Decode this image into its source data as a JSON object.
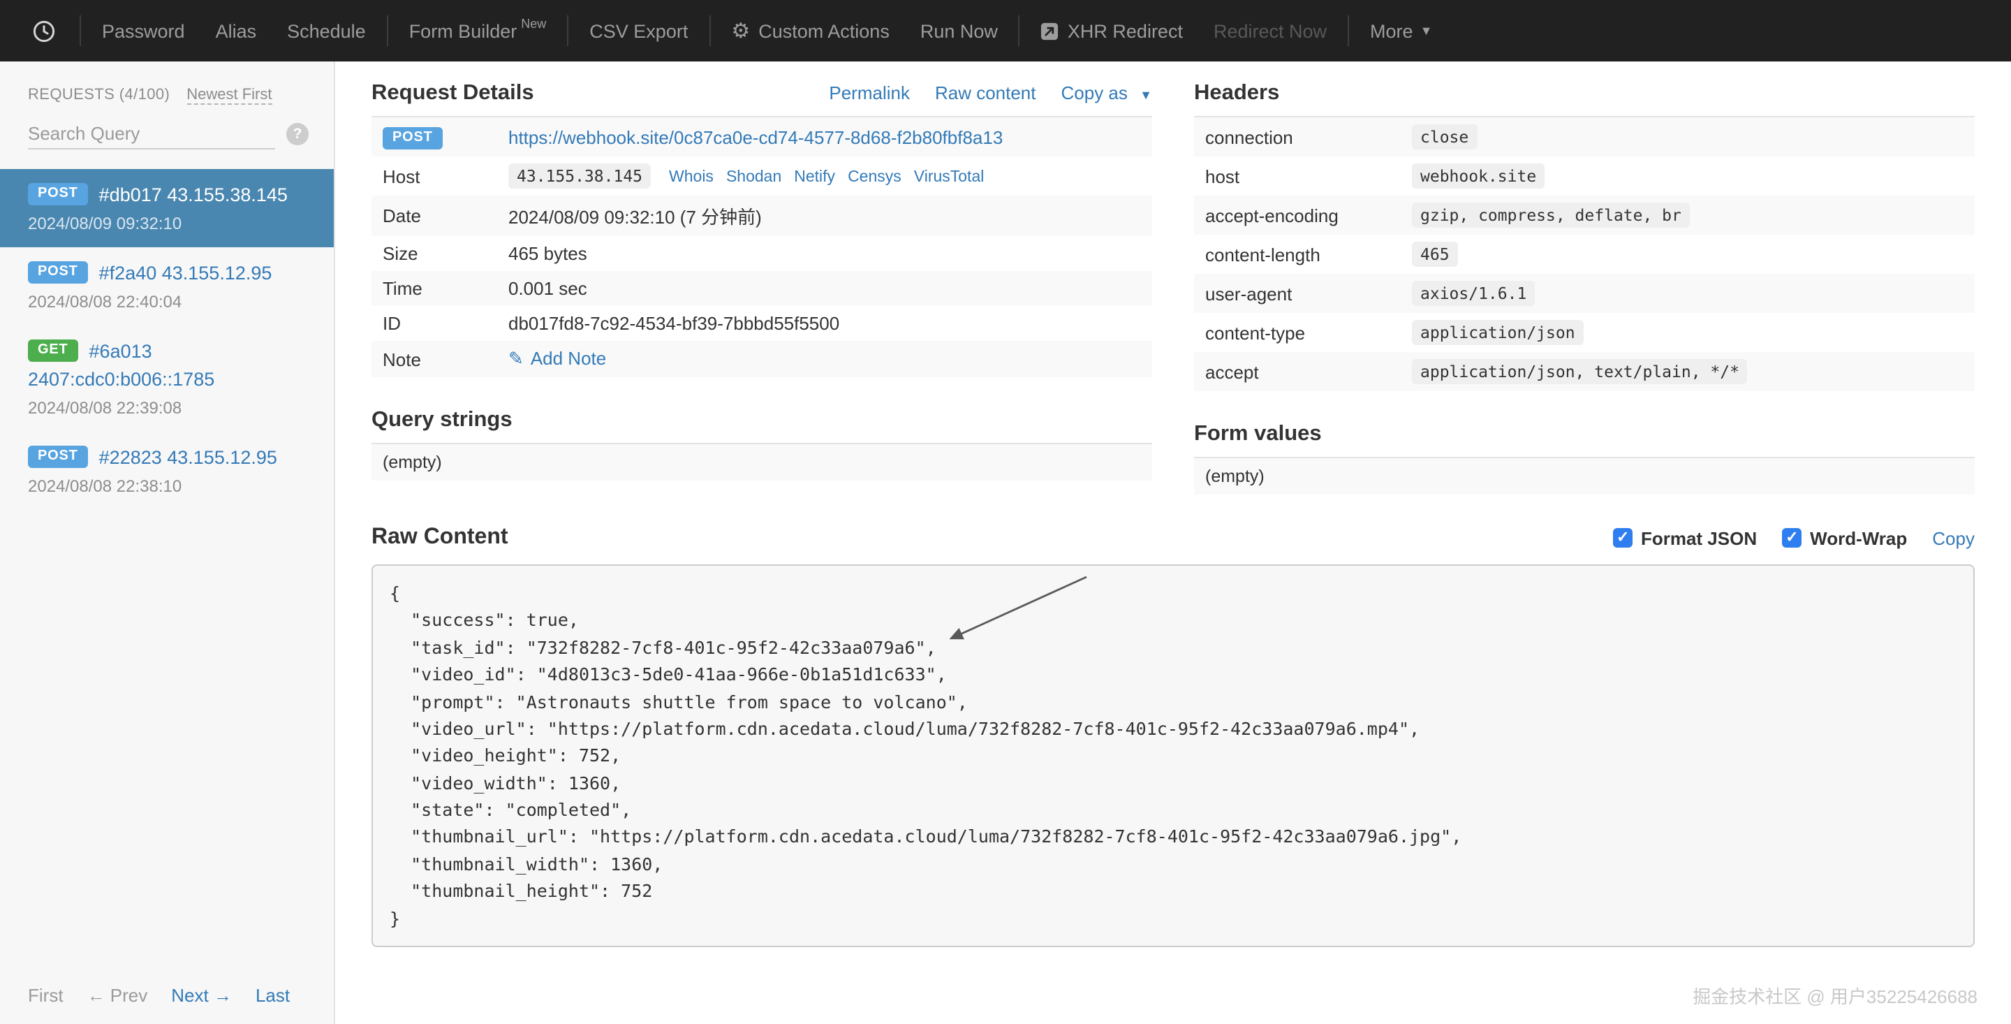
{
  "theme": {
    "link": "#337ab7",
    "post": "#57a4e1",
    "get": "#4cae4c",
    "selected": "#4a87b0",
    "navbg": "#212121",
    "check": "#2e7ef0"
  },
  "nav": {
    "password": "Password",
    "alias": "Alias",
    "schedule": "Schedule",
    "form_builder": "Form Builder",
    "form_builder_badge": "New",
    "csv_export": "CSV Export",
    "custom_actions": "Custom Actions",
    "run_now": "Run Now",
    "xhr_redirect": "XHR Redirect",
    "redirect_now": "Redirect Now",
    "more": "More"
  },
  "sidebar": {
    "header": "REQUESTS (4/100)",
    "sort_label": "Newest First",
    "search_placeholder": "Search Query",
    "requests": [
      {
        "method": "POST",
        "title": "#db017 43.155.38.145",
        "date": "2024/08/09 09:32:10"
      },
      {
        "method": "POST",
        "title": "#f2a40 43.155.12.95",
        "date": "2024/08/08 22:40:04"
      },
      {
        "method": "GET",
        "title": "#6a013",
        "subtitle": "2407:cdc0:b006::1785",
        "date": "2024/08/08 22:39:08"
      },
      {
        "method": "POST",
        "title": "#22823 43.155.12.95",
        "date": "2024/08/08 22:38:10"
      }
    ],
    "pagination": {
      "first": "First",
      "prev": "← Prev",
      "next": "Next →",
      "last": "Last"
    }
  },
  "request_details": {
    "title": "Request Details",
    "permalink": "Permalink",
    "raw_content_link": "Raw content",
    "copy_as": "Copy as",
    "method": "POST",
    "url": "https://webhook.site/0c87ca0e-cd74-4577-8d68-f2b80fbf8a13",
    "host_label": "Host",
    "host_value": "43.155.38.145",
    "host_links": [
      "Whois",
      "Shodan",
      "Netify",
      "Censys",
      "VirusTotal"
    ],
    "date_label": "Date",
    "date_value": "2024/08/09 09:32:10 (7 分钟前)",
    "size_label": "Size",
    "size_value": "465 bytes",
    "time_label": "Time",
    "time_value": "0.001 sec",
    "id_label": "ID",
    "id_value": "db017fd8-7c92-4534-bf39-7bbbd55f5500",
    "note_label": "Note",
    "note_action": "Add Note"
  },
  "query_strings": {
    "title": "Query strings",
    "empty": "(empty)"
  },
  "headers": {
    "title": "Headers",
    "rows": [
      {
        "name": "connection",
        "value": "close"
      },
      {
        "name": "host",
        "value": "webhook.site"
      },
      {
        "name": "accept-encoding",
        "value": "gzip, compress, deflate, br"
      },
      {
        "name": "content-length",
        "value": "465"
      },
      {
        "name": "user-agent",
        "value": "axios/1.6.1"
      },
      {
        "name": "content-type",
        "value": "application/json"
      },
      {
        "name": "accept",
        "value": "application/json, text/plain, */*"
      }
    ]
  },
  "form_values": {
    "title": "Form values",
    "empty": "(empty)"
  },
  "raw_content": {
    "title": "Raw Content",
    "format_json_label": "Format JSON",
    "word_wrap_label": "Word-Wrap",
    "copy_label": "Copy",
    "body": "{\n  \"success\": true,\n  \"task_id\": \"732f8282-7cf8-401c-95f2-42c33aa079a6\",\n  \"video_id\": \"4d8013c3-5de0-41aa-966e-0b1a51d1c633\",\n  \"prompt\": \"Astronauts shuttle from space to volcano\",\n  \"video_url\": \"https://platform.cdn.acedata.cloud/luma/732f8282-7cf8-401c-95f2-42c33aa079a6.mp4\",\n  \"video_height\": 752,\n  \"video_width\": 1360,\n  \"state\": \"completed\",\n  \"thumbnail_url\": \"https://platform.cdn.acedata.cloud/luma/732f8282-7cf8-401c-95f2-42c33aa079a6.jpg\",\n  \"thumbnail_width\": 1360,\n  \"thumbnail_height\": 752\n}"
  },
  "watermark": "掘金技术社区 @ 用户35225426688"
}
